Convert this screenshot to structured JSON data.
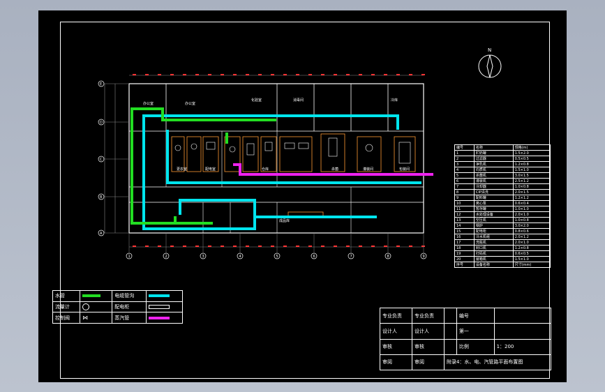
{
  "drawing": {
    "north_label": "N",
    "grid_rows": [
      "E",
      "D",
      "C",
      "B",
      "A"
    ],
    "grid_cols": [
      "1",
      "2",
      "3",
      "4",
      "5",
      "6",
      "7",
      "8",
      "9"
    ],
    "room_labels": [
      {
        "id": "r1",
        "text": "办公室"
      },
      {
        "id": "r2",
        "text": "办公室"
      },
      {
        "id": "r3",
        "text": "化验室"
      },
      {
        "id": "r4",
        "text": "更衣室"
      },
      {
        "id": "r5",
        "text": "配电室"
      },
      {
        "id": "r6",
        "text": "仓库"
      },
      {
        "id": "r7",
        "text": "消毒间"
      },
      {
        "id": "r8",
        "text": "杀菌"
      },
      {
        "id": "r9",
        "text": "灌装间"
      },
      {
        "id": "r10",
        "text": "包装间"
      },
      {
        "id": "r11",
        "text": "成品库"
      },
      {
        "id": "r12",
        "text": "冷库"
      }
    ]
  },
  "legend": {
    "water_pipe": "水管",
    "cable_trench": "电缆管沟",
    "flow_meter": "流量计",
    "distribution_cabinet": "配电柜",
    "control_valve": "控制阀",
    "steam_pipe": "蒸汽管"
  },
  "schedule": {
    "headers": [
      "编号",
      "名称",
      "规格(m)"
    ],
    "rows": [
      [
        "1",
        "贮奶罐",
        "1.5×2.0"
      ],
      [
        "2",
        "过滤器",
        "0.5×0.5"
      ],
      [
        "3",
        "净乳机",
        "1.2×0.8"
      ],
      [
        "4",
        "均质机",
        "1.5×1.0"
      ],
      [
        "5",
        "杀菌机",
        "3.0×1.5"
      ],
      [
        "6",
        "灌装机",
        "2.5×1.2"
      ],
      [
        "7",
        "冷却器",
        "1.0×0.8"
      ],
      [
        "8",
        "CIP清洗",
        "2.0×1.5"
      ],
      [
        "9",
        "配料罐",
        "1.2×1.2"
      ],
      [
        "10",
        "离心泵",
        "0.6×0.4"
      ],
      [
        "11",
        "暂存罐",
        "1.0×1.0"
      ],
      [
        "12",
        "水处理设备",
        "2.0×1.0"
      ],
      [
        "13",
        "空压机",
        "1.0×0.8"
      ],
      [
        "14",
        "锅炉",
        "3.0×2.0"
      ],
      [
        "15",
        "配电柜",
        "0.8×0.6"
      ],
      [
        "16",
        "冷水机组",
        "2.0×1.2"
      ],
      [
        "17",
        "洗瓶机",
        "2.0×1.0"
      ],
      [
        "18",
        "封口机",
        "1.2×0.8"
      ],
      [
        "19",
        "打码机",
        "0.6×0.5"
      ],
      [
        "20",
        "装箱机",
        "1.5×1.0"
      ],
      [
        "序号",
        "设备名称",
        "尺寸(mm)"
      ]
    ]
  },
  "titleblock": {
    "major_head_label": "专业负责",
    "major_head_value": "专业负责",
    "number_label": "编号",
    "designer_label": "设计人",
    "designer_value": "设计人",
    "sheet_label": "第一",
    "approved_label": "审核",
    "approved_value": "审核",
    "scale_label": "比例",
    "scale_value": "1：200",
    "checked_label": "审阅",
    "checked_value": "审阅",
    "drawing_title": "附录4：水、电、汽管路平面布置图"
  },
  "colors": {
    "water": "#22dd22",
    "cable": "#00e5ee",
    "steam": "#ee22ee",
    "wall": "#ffffff",
    "dim": "#ff3333",
    "equipment": "#ff9933"
  }
}
